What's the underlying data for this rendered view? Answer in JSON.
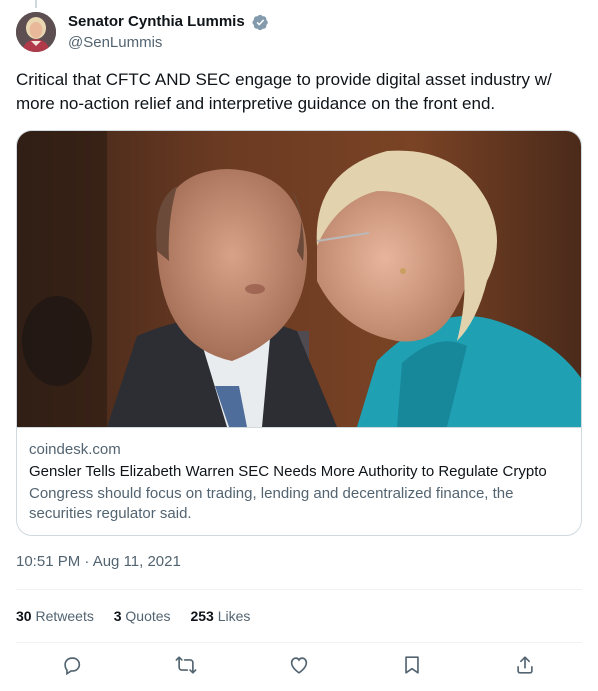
{
  "author": {
    "display_name": "Senator Cynthia Lummis",
    "handle": "@SenLummis",
    "avatar_icon": "avatar-portrait",
    "verified_icon": "verified-badge-icon"
  },
  "tweet": {
    "text": "Critical that CFTC AND SEC engage to provide digital asset industry w/ more no-action relief and interpretive guidance on the front end.",
    "timestamp": "10:51 PM · Aug 11, 2021"
  },
  "card": {
    "domain": "coindesk.com",
    "title": "Gensler Tells Elizabeth Warren SEC Needs More Authority to Regulate Crypto",
    "description": "Congress should focus on trading, lending and decentralized finance, the securities regulator said."
  },
  "stats": {
    "retweets_count": "30",
    "retweets_label": "Retweets",
    "quotes_count": "3",
    "quotes_label": "Quotes",
    "likes_count": "253",
    "likes_label": "Likes"
  },
  "actions": [
    "reply-icon",
    "retweet-icon",
    "like-icon",
    "bookmark-icon",
    "share-icon"
  ],
  "colors": {
    "text": "#0f1419",
    "secondary": "#536471",
    "border": "#cfd9de",
    "verified": "#829aab",
    "accent": "#1d9bf0"
  }
}
